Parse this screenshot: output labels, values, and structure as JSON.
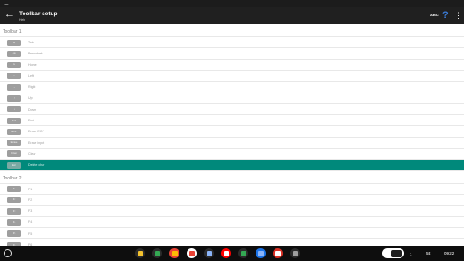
{
  "system_bar": {
    "back_glyph": "←",
    "minimize_glyph": "—",
    "maximize_glyph": "▢",
    "close_glyph": "✕"
  },
  "app_bar": {
    "back_glyph": "←",
    "title": "Toolbar setup",
    "subtitle": "Help",
    "abc_label": "ABC",
    "help_glyph": "?",
    "more_glyph": "⋮"
  },
  "sections": [
    {
      "header": "Toolbar 1",
      "items": [
        {
          "key": "↹",
          "label": "Tab"
        },
        {
          "key": "⌫",
          "label": "Backslash"
        },
        {
          "key": "⇤",
          "label": "Home"
        },
        {
          "key": "←",
          "label": "Left"
        },
        {
          "key": "→",
          "label": "Right"
        },
        {
          "key": "↑",
          "label": "Up"
        },
        {
          "key": "↓",
          "label": "Down"
        },
        {
          "key": "End",
          "label": "End"
        },
        {
          "key": "EOF",
          "label": "Erase EOF"
        },
        {
          "key": "Erase",
          "label": "Erase input"
        },
        {
          "key": "Clear",
          "label": "Clear"
        },
        {
          "key": "Esc",
          "label": "Delete char",
          "selected": true
        }
      ]
    },
    {
      "header": "Toolbar 2",
      "items": [
        {
          "key": "F1",
          "label": "F1"
        },
        {
          "key": "F2",
          "label": "F2"
        },
        {
          "key": "F3",
          "label": "F3"
        },
        {
          "key": "F4",
          "label": "F4"
        },
        {
          "key": "F5",
          "label": "F5"
        },
        {
          "key": "F6",
          "label": "F6"
        }
      ]
    }
  ],
  "shelf": {
    "apps": [
      {
        "name": "chrome-beta",
        "bg": "#2b2b2b",
        "fg": "#f2c12e"
      },
      {
        "name": "sheets",
        "bg": "#2b2b2b",
        "fg": "#34a853"
      },
      {
        "name": "chrome",
        "bg": "#ea4335",
        "fg": "#fbbc05"
      },
      {
        "name": "gmail",
        "bg": "#ffffff",
        "fg": "#ea4335"
      },
      {
        "name": "files-app",
        "bg": "#2b2b2b",
        "fg": "#8ab4f8"
      },
      {
        "name": "youtube",
        "bg": "#ff0000",
        "fg": "#ffffff"
      },
      {
        "name": "play-store",
        "bg": "#2b2b2b",
        "fg": "#34a853"
      },
      {
        "name": "files",
        "bg": "#1a73e8",
        "fg": "#8ab4f8"
      },
      {
        "name": "calendar",
        "bg": "#d93025",
        "fg": "#ffffff"
      },
      {
        "name": "terminal",
        "bg": "#2b2b2b",
        "fg": "#9e9e9e"
      }
    ],
    "status": {
      "notification_count": "1",
      "network": "5E",
      "time": "09:22"
    }
  }
}
